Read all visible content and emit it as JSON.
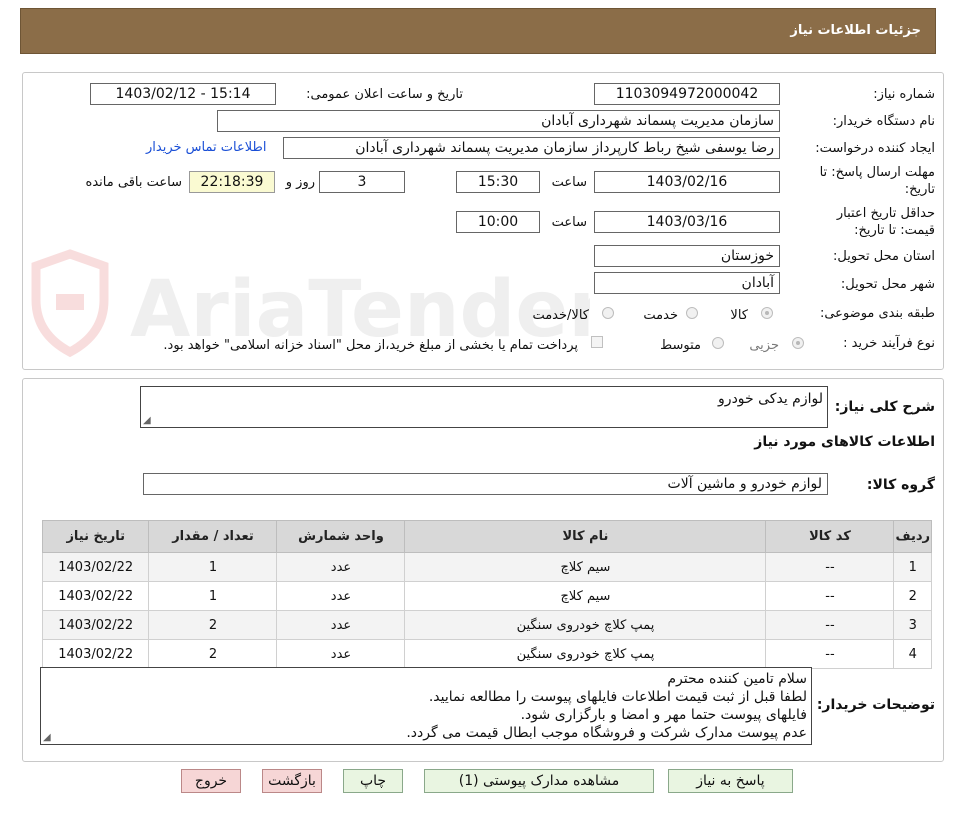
{
  "header": {
    "title": "جزئیات اطلاعات نیاز"
  },
  "form": {
    "need_number_label": "شماره نیاز:",
    "need_number": "1103094972000042",
    "announce_label": "تاریخ و ساعت اعلان عمومی:",
    "announce_value": "1403/02/12 - 15:14",
    "buyer_org_label": "نام دستگاه خریدار:",
    "buyer_org": "سازمان مدیریت پسماند شهرداری آبادان",
    "requester_label": "ایجاد کننده درخواست:",
    "requester": "رضا یوسفی شیخ رباط کارپرداز سازمان مدیریت پسماند شهرداری آبادان",
    "contact_link": "اطلاعات تماس خریدار",
    "deadline_label_1": "مهلت ارسال پاسخ: تا",
    "deadline_label_2": "تاریخ:",
    "deadline_date": "1403/02/16",
    "time_label": "ساعت",
    "deadline_time": "15:30",
    "days_value": "3",
    "days_label": "روز و",
    "remaining_time": "22:18:39",
    "remaining_label": "ساعت باقی مانده",
    "validity_label_1": "حداقل تاریخ اعتبار",
    "validity_label_2": "قیمت: تا تاریخ:",
    "validity_date": "1403/03/16",
    "validity_time": "10:00",
    "province_label": "استان محل تحویل:",
    "province": "خوزستان",
    "city_label": "شهر محل تحویل:",
    "city": "آبادان",
    "category_label": "طبقه بندی موضوعی:",
    "category_options": [
      "کالا",
      "خدمت",
      "کالا/خدمت"
    ],
    "category_selected": "کالا",
    "process_label": "نوع فرآیند خرید :",
    "process_options": [
      "جزیی",
      "متوسط"
    ],
    "process_selected": "جزیی",
    "payment_note": "پرداخت تمام یا بخشی از مبلغ خرید،از محل \"اسناد خزانه اسلامی\" خواهد بود."
  },
  "details": {
    "summary_label": "شرح کلی نیاز:",
    "summary": "لوازم یدکی خودرو",
    "goods_info_title": "اطلاعات کالاهای مورد نیاز",
    "goods_group_label": "گروه کالا:",
    "goods_group": "لوازم خودرو و ماشین آلات",
    "table": {
      "headers": [
        "ردیف",
        "کد کالا",
        "نام کالا",
        "واحد شمارش",
        "تعداد / مقدار",
        "تاریخ نیاز"
      ],
      "rows": [
        [
          "1",
          "--",
          "سیم کلاچ",
          "عدد",
          "1",
          "1403/02/22"
        ],
        [
          "2",
          "--",
          "سیم کلاچ",
          "عدد",
          "1",
          "1403/02/22"
        ],
        [
          "3",
          "--",
          "پمپ کلاچ خودروی سنگین",
          "عدد",
          "2",
          "1403/02/22"
        ],
        [
          "4",
          "--",
          "پمپ کلاچ خودروی سنگین",
          "عدد",
          "2",
          "1403/02/22"
        ]
      ]
    },
    "buyer_notes_label": "توضیحات خریدار:",
    "buyer_notes": [
      "سلام تامین کننده محترم",
      "لطفا قبل از ثبت قیمت اطلاعات فایلهای پیوست را مطالعه نمایید.",
      "فایلهای پیوست حتما مهر و امضا و بارگزاری شود.",
      "عدم پیوست مدارک شرکت و فروشگاه موجب ابطال قیمت می گردد."
    ]
  },
  "buttons": {
    "reply": "پاسخ به نیاز",
    "attachments": "مشاهده مدارک پیوستی (1)",
    "print": "چاپ",
    "back": "بازگشت",
    "exit": "خروج"
  },
  "watermark": {
    "text": "AriaTender.neT"
  },
  "colors": {
    "header_bg": "#8B6D48",
    "link": "#1a4fd6",
    "remaining_bg": "#fafad2",
    "button_bg": "#e9f5e1",
    "button_red_bg": "#f6d6d6"
  }
}
